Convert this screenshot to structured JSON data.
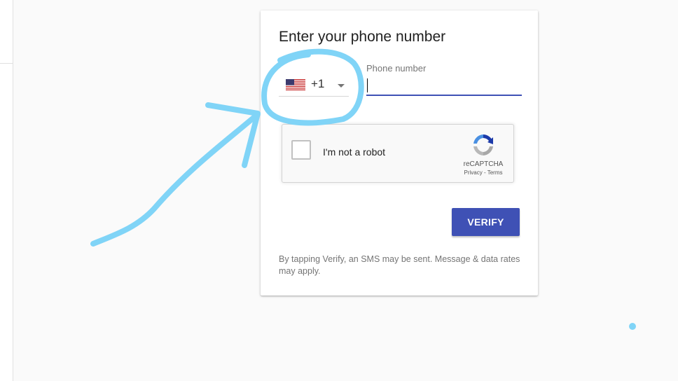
{
  "dialog": {
    "title": "Enter your phone number",
    "country_code": "+1",
    "country_flag_icon": "us-flag-icon",
    "phone_label": "Phone number",
    "phone_value": "",
    "verify_label": "VERIFY",
    "disclaimer": "By tapping Verify, an SMS may be sent. Message & data rates may apply."
  },
  "recaptcha": {
    "checkbox_label": "I'm not a robot",
    "brand": "reCAPTCHA",
    "privacy_label": "Privacy",
    "separator": " - ",
    "terms_label": "Terms",
    "checked": false
  },
  "colors": {
    "accent": "#3f51b5",
    "annotation_ink": "#80d4f7",
    "background": "#fafafa"
  }
}
